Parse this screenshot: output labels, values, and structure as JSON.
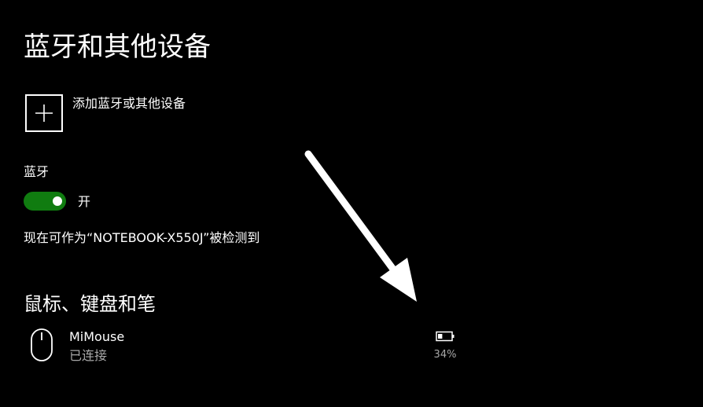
{
  "page": {
    "title": "蓝牙和其他设备"
  },
  "add_device": {
    "label": "添加蓝牙或其他设备",
    "icon": "plus-icon"
  },
  "bluetooth": {
    "heading": "蓝牙",
    "toggle_state": "on",
    "toggle_label": "开",
    "discoverable_text": "现在可作为“NOTEBOOK-X550J”被检测到",
    "toggle_color": "#107c10"
  },
  "mice_section": {
    "heading": "鼠标、键盘和笔",
    "devices": [
      {
        "name": "MiMouse",
        "status": "已连接",
        "battery": "34%",
        "battery_level": 0.34,
        "icon": "mouse-icon",
        "battery_icon": "battery-icon"
      }
    ]
  },
  "colors": {
    "background": "#000000",
    "text": "#ffffff",
    "secondary_text": "#a8a8a8"
  }
}
